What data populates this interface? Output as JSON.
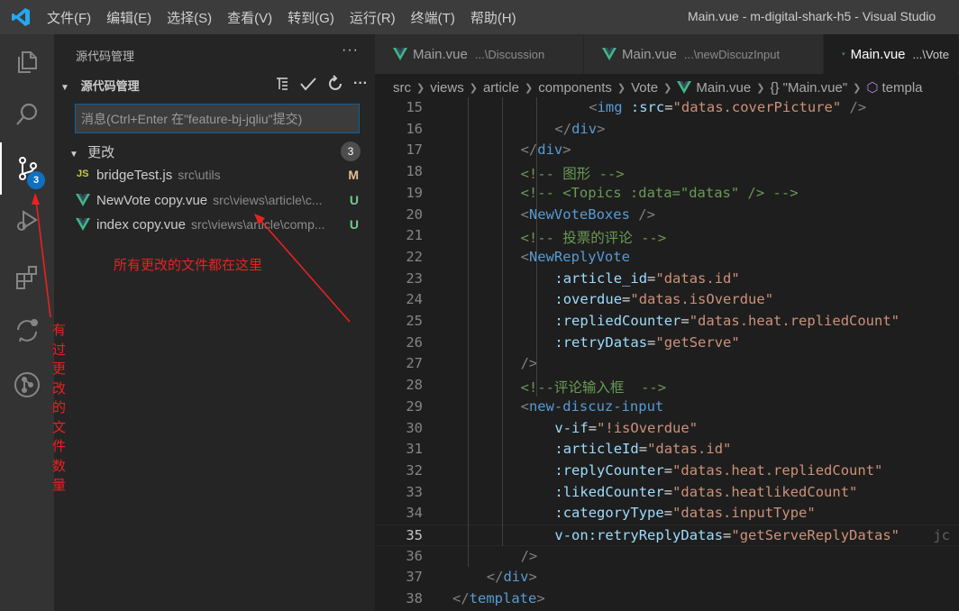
{
  "menu": {
    "items": [
      "文件(F)",
      "编辑(E)",
      "选择(S)",
      "查看(V)",
      "转到(G)",
      "运行(R)",
      "终端(T)",
      "帮助(H)"
    ],
    "window_title": "Main.vue - m-digital-shark-h5 - Visual Studio"
  },
  "activity": {
    "scm_badge": "3"
  },
  "sidebar": {
    "title": "源代码管理",
    "more": "···",
    "section": "源代码管理",
    "commit_placeholder": "消息(Ctrl+Enter 在\"feature-bj-jqliu\"提交)",
    "changes_label": "更改",
    "changes_count": "3",
    "files": [
      {
        "icon": "JS",
        "name": "bridgeTest.js",
        "path": "src\\utils",
        "status": "M"
      },
      {
        "icon": "V",
        "name": "NewVote copy.vue",
        "path": "src\\views\\article\\c...",
        "status": "U"
      },
      {
        "icon": "V",
        "name": "index copy.vue",
        "path": "src\\views\\article\\comp...",
        "status": "U"
      }
    ]
  },
  "annotations": {
    "files_note": "所有更改的文件都在这里",
    "badge_note": "有过更改的文件数量"
  },
  "tabs": [
    {
      "name": "Main.vue",
      "desc": "...\\Discussion"
    },
    {
      "name": "Main.vue",
      "desc": "...\\newDiscuzInput"
    },
    {
      "name": "Main.vue",
      "desc": "...\\Vote"
    }
  ],
  "breadcrumb": [
    "src",
    "views",
    "article",
    "components",
    "Vote",
    "Main.vue",
    "{} \"Main.vue\"",
    "templa"
  ],
  "code": {
    "current_line": 35,
    "lines": [
      {
        "n": 15,
        "ind": 8,
        "t": "<img :src=\"datas.coverPicture\" />"
      },
      {
        "n": 16,
        "ind": 6,
        "t": "</div>"
      },
      {
        "n": 17,
        "ind": 4,
        "t": "</div>"
      },
      {
        "n": 18,
        "ind": 4,
        "t": "<!-- 图形 -->"
      },
      {
        "n": 19,
        "ind": 4,
        "t": "<!-- <Topics :data=\"datas\" /> -->"
      },
      {
        "n": 20,
        "ind": 4,
        "t": "<NewVoteBoxes />"
      },
      {
        "n": 21,
        "ind": 4,
        "t": "<!-- 投票的评论 -->"
      },
      {
        "n": 22,
        "ind": 4,
        "t": "<NewReplyVote"
      },
      {
        "n": 23,
        "ind": 6,
        "t": ":article_id=\"datas.id\""
      },
      {
        "n": 24,
        "ind": 6,
        "t": ":overdue=\"datas.isOverdue\""
      },
      {
        "n": 25,
        "ind": 6,
        "t": ":repliedCounter=\"datas.heat.repliedCount\""
      },
      {
        "n": 26,
        "ind": 6,
        "t": ":retryDatas=\"getServe\""
      },
      {
        "n": 27,
        "ind": 4,
        "t": "/>"
      },
      {
        "n": 28,
        "ind": 4,
        "t": "<!--评论输入框  -->"
      },
      {
        "n": 29,
        "ind": 4,
        "t": "<new-discuz-input"
      },
      {
        "n": 30,
        "ind": 6,
        "t": "v-if=\"!isOverdue\""
      },
      {
        "n": 31,
        "ind": 6,
        "t": ":articleId=\"datas.id\""
      },
      {
        "n": 32,
        "ind": 6,
        "t": ":replyCounter=\"datas.heat.repliedCount\""
      },
      {
        "n": 33,
        "ind": 6,
        "t": ":likedCounter=\"datas.heatlikedCount\""
      },
      {
        "n": 34,
        "ind": 6,
        "t": ":categoryType=\"datas.inputType\""
      },
      {
        "n": 35,
        "ind": 6,
        "t": "v-on:retryReplyDatas=\"getServeReplyDatas\"    jc"
      },
      {
        "n": 36,
        "ind": 4,
        "t": "/>"
      },
      {
        "n": 37,
        "ind": 2,
        "t": "</div>"
      },
      {
        "n": 38,
        "ind": 0,
        "t": "</template>"
      }
    ]
  },
  "colors": {
    "accent": "#0e70c0",
    "annotation": "#e8221f",
    "vue": "#41b883",
    "js": "#cbcb41"
  }
}
